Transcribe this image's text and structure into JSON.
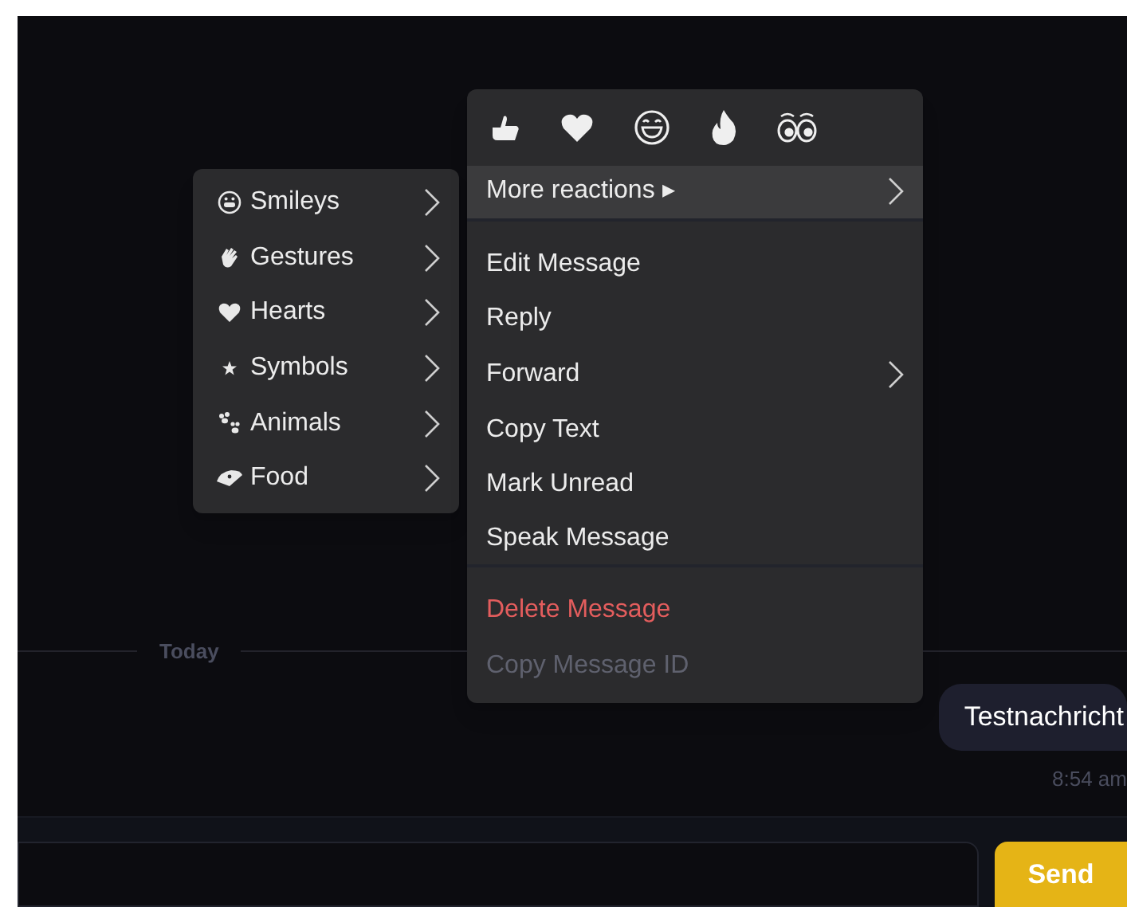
{
  "chat": {
    "date_divider": "Today",
    "messages": [
      {
        "text": "Testnachricht",
        "time": "8:54 am",
        "own": true
      }
    ]
  },
  "composer": {
    "send_button": "Send"
  },
  "context_menu": {
    "items": [
      {
        "label": "More reactions ▸",
        "selected": true,
        "kind": "normal",
        "disabled": false,
        "submenu": true,
        "divider_after": true
      },
      {
        "label": "Edit Message",
        "selected": false,
        "kind": "normal",
        "disabled": false,
        "submenu": false,
        "divider_after": false
      },
      {
        "label": "Reply",
        "selected": false,
        "kind": "normal",
        "disabled": false,
        "submenu": false,
        "divider_after": false
      },
      {
        "label": "Forward",
        "selected": false,
        "kind": "normal",
        "disabled": false,
        "submenu": true,
        "divider_after": false
      },
      {
        "label": "Copy Text",
        "selected": false,
        "kind": "normal",
        "disabled": false,
        "submenu": false,
        "divider_after": false
      },
      {
        "label": "Mark Unread",
        "selected": false,
        "kind": "normal",
        "disabled": false,
        "submenu": false,
        "divider_after": false
      },
      {
        "label": "Speak Message",
        "selected": false,
        "kind": "normal",
        "disabled": false,
        "submenu": false,
        "divider_after": true
      },
      {
        "label": "Delete Message",
        "selected": false,
        "kind": "danger",
        "disabled": false,
        "submenu": false,
        "divider_after": false
      },
      {
        "label": "Copy Message ID",
        "selected": false,
        "kind": "normal",
        "disabled": true,
        "submenu": false,
        "divider_after": false
      }
    ]
  },
  "reaction_submenu": {
    "items": [
      {
        "label": "Smileys",
        "kind": "smiley",
        "submenu": true
      },
      {
        "label": "Gestures",
        "kind": "hand",
        "submenu": true
      },
      {
        "label": "Hearts",
        "kind": "heart",
        "submenu": true
      },
      {
        "label": "Symbols",
        "kind": "star",
        "submenu": true
      },
      {
        "label": "Animals",
        "kind": "paw",
        "submenu": true
      },
      {
        "label": "Food",
        "kind": "food",
        "submenu": true
      }
    ]
  }
}
